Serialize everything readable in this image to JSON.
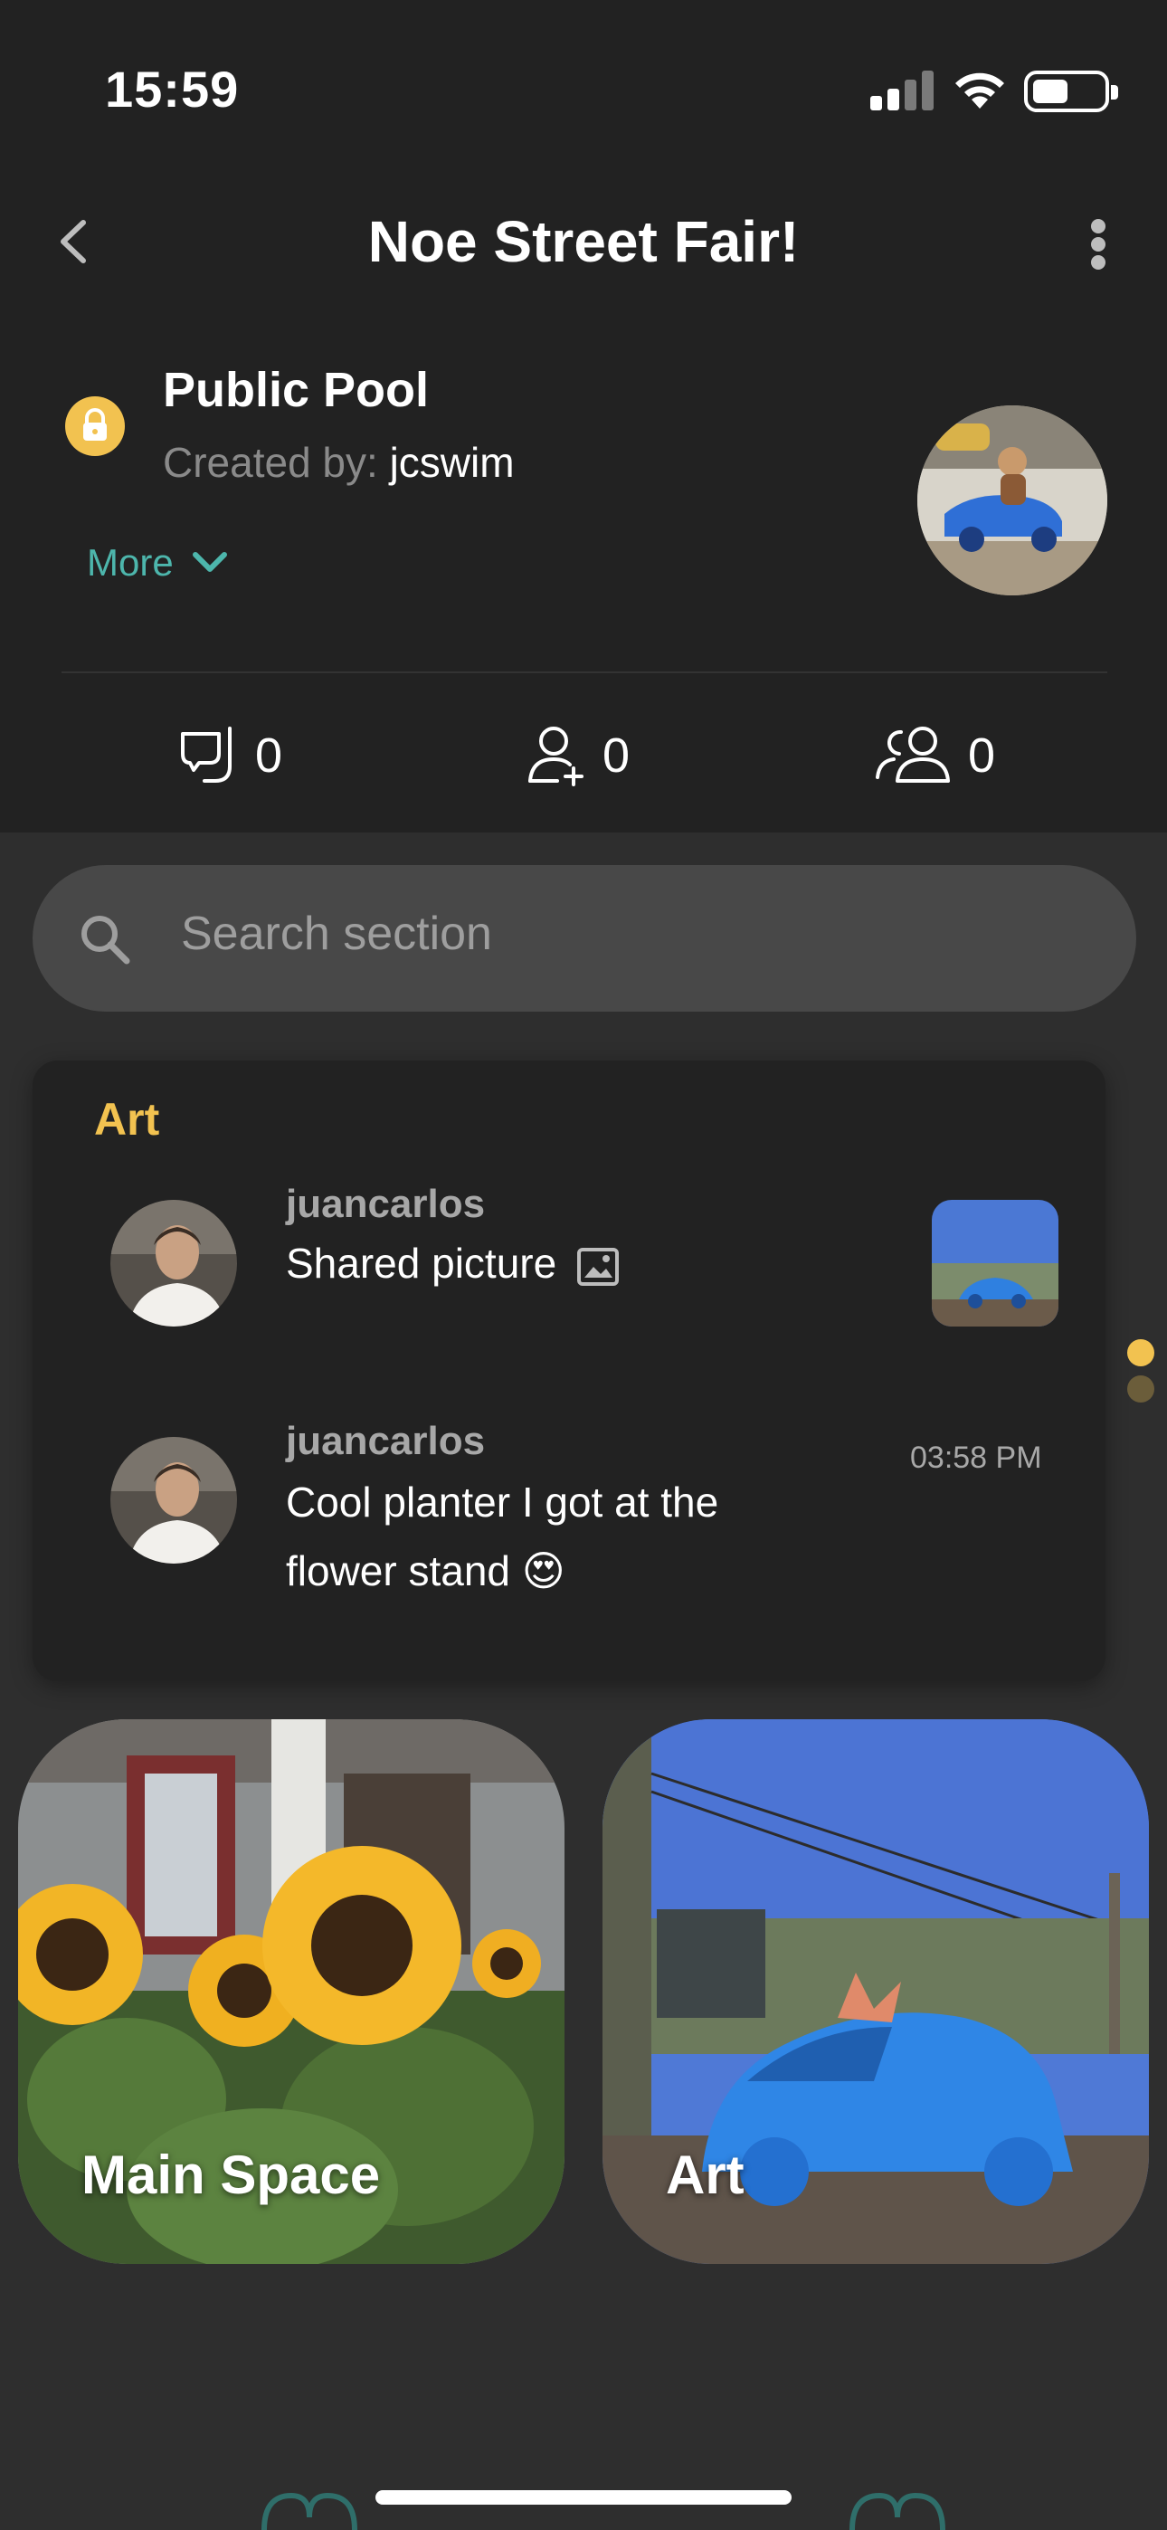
{
  "status_bar": {
    "time": "15:59"
  },
  "header": {
    "title": "Noe Street Fair!",
    "back_icon": "chevron-left-icon",
    "menu_icon": "more-vertical-icon"
  },
  "space": {
    "name": "Public Pool",
    "created_by_label": "Created by:",
    "created_by_user": "jcswim",
    "more_label": "More",
    "lock_color": "#f2c250"
  },
  "stats": [
    {
      "icon": "snorkel-mask-icon",
      "value": "0"
    },
    {
      "icon": "add-user-icon",
      "value": "0"
    },
    {
      "icon": "group-icon",
      "value": "0"
    }
  ],
  "search": {
    "placeholder": "Search section"
  },
  "feed": {
    "section": "Art",
    "messages": [
      {
        "user": "juancarlos",
        "text": "Shared picture",
        "time": ""
      },
      {
        "user": "juancarlos",
        "text_line1": "Cool planter I got at the",
        "text_line2": "flower stand 😍",
        "time": "03:58 PM"
      }
    ]
  },
  "tiles": [
    {
      "label": "Main Space"
    },
    {
      "label": "Art"
    }
  ],
  "colors": {
    "accent_yellow": "#f2c250",
    "accent_teal": "#4db6ac",
    "background": "#2e2e2e",
    "header_bg": "#222222"
  }
}
